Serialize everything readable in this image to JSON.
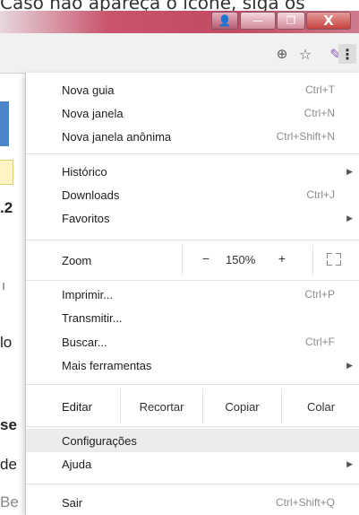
{
  "caption": "Caso não apareça o ícone, siga os",
  "window": {
    "close_glyph": "X",
    "minimize_glyph": "—",
    "maximize_glyph": "❐",
    "user_glyph": "👤"
  },
  "toolbar": {
    "zoom_icon": "⊕",
    "star_icon": "☆",
    "ext_icon": "✎",
    "menu_icon": "⋮"
  },
  "background_fragments": [
    {
      "text": ".2"
    },
    {
      "text": "ı"
    },
    {
      "text": "lo"
    },
    {
      "text": "se"
    },
    {
      "text": "de"
    },
    {
      "text": "Be"
    }
  ],
  "menu": {
    "new_tab": {
      "label": "Nova guia",
      "shortcut": "Ctrl+T"
    },
    "new_window": {
      "label": "Nova janela",
      "shortcut": "Ctrl+N"
    },
    "incognito": {
      "label": "Nova janela anônima",
      "shortcut": "Ctrl+Shift+N"
    },
    "history": {
      "label": "Histórico",
      "arrow": "▶"
    },
    "downloads": {
      "label": "Downloads",
      "shortcut": "Ctrl+J"
    },
    "bookmarks": {
      "label": "Favoritos",
      "arrow": "▶"
    },
    "zoom": {
      "label": "Zoom",
      "minus": "−",
      "value": "150%",
      "plus": "+"
    },
    "print": {
      "label": "Imprimir...",
      "shortcut": "Ctrl+P"
    },
    "cast": {
      "label": "Transmitir..."
    },
    "find": {
      "label": "Buscar...",
      "shortcut": "Ctrl+F"
    },
    "more_tools": {
      "label": "Mais ferramentas",
      "arrow": "▶"
    },
    "edit": {
      "label": "Editar",
      "cut": "Recortar",
      "copy": "Copiar",
      "paste": "Colar"
    },
    "settings": {
      "label": "Configurações"
    },
    "help": {
      "label": "Ajuda",
      "arrow": "▶"
    },
    "exit": {
      "label": "Sair",
      "shortcut": "Ctrl+Shift+Q"
    }
  }
}
